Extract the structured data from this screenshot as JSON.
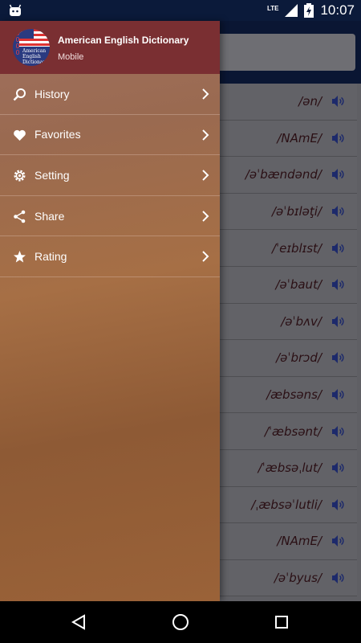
{
  "status_bar": {
    "time": "10:07",
    "network": "LTE",
    "icons": [
      "android-icon",
      "lte-icon",
      "signal-icon",
      "battery-charging-icon"
    ]
  },
  "drawer": {
    "app_title": "American English Dictionary",
    "app_subtitle": "Mobile",
    "logo": {
      "numbers": "3000",
      "text": "American English Dictionary"
    },
    "menu": [
      {
        "label": "History",
        "icon": "search-icon"
      },
      {
        "label": "Favorites",
        "icon": "heart-icon"
      },
      {
        "label": "Setting",
        "icon": "gear-icon"
      },
      {
        "label": "Share",
        "icon": "share-icon"
      },
      {
        "label": "Rating",
        "icon": "star-icon"
      }
    ]
  },
  "word_list": [
    {
      "pronunciation": "/ən/"
    },
    {
      "pronunciation": "/NAmE/"
    },
    {
      "pronunciation": "/əˈbændənd/"
    },
    {
      "pronunciation": "/əˈbɪləţi/"
    },
    {
      "pronunciation": "/ˈeɪblɪst/"
    },
    {
      "pronunciation": "/əˈbaut/"
    },
    {
      "pronunciation": "/əˈbʌv/"
    },
    {
      "pronunciation": "/əˈbrɔd/"
    },
    {
      "pronunciation": "/æbsəns/"
    },
    {
      "pronunciation": "/ˈæbsənt/"
    },
    {
      "pronunciation": "/ˈæbsəˌlut/"
    },
    {
      "pronunciation": "/ˌæbsəˈlutli/"
    },
    {
      "pronunciation": "/NAmE/"
    },
    {
      "pronunciation": "/əˈbyus/"
    }
  ],
  "colors": {
    "status_bar": "#0b1a3a",
    "drawer_header": "#7a2f32",
    "pronunciation_text": "#2a0f14",
    "speaker_icon": "#1d2a6b"
  }
}
